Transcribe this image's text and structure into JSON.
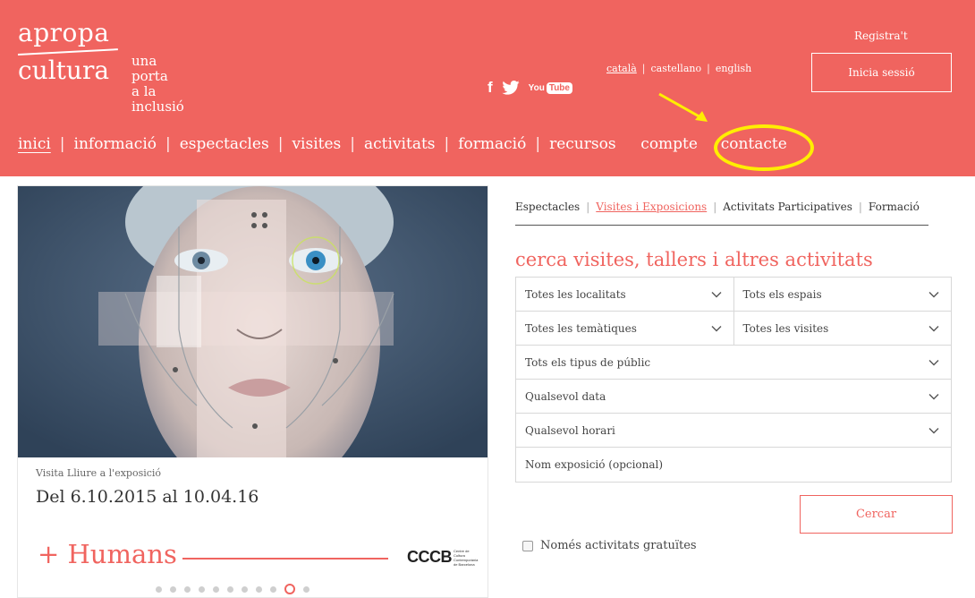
{
  "logo": {
    "top": "apropa",
    "bottom": "cultura",
    "tagline_line1": "una porta",
    "tagline_line2": "a la inclusió"
  },
  "social": {
    "facebook": "f",
    "youtube_prefix": "You",
    "youtube_box": "Tube"
  },
  "languages": {
    "catala": "català",
    "sep1": "|",
    "castellano": "castellano",
    "sep2": "|",
    "english": "english"
  },
  "account": {
    "register": "Registra't",
    "login": "Inicia sessió"
  },
  "nav": {
    "items": [
      {
        "label": "inici",
        "active": true
      },
      {
        "label": "informació"
      },
      {
        "label": "espectacles"
      },
      {
        "label": "visites"
      },
      {
        "label": "activitats"
      },
      {
        "label": "formació"
      },
      {
        "label": "recursos"
      },
      {
        "label": "compte"
      },
      {
        "label": "contacte"
      }
    ],
    "separator": "|"
  },
  "feature": {
    "caption": "Visita Lliure a l'exposició",
    "dates": "Del 6.10.2015 al 10.04.16",
    "title": "+ Humans",
    "partner_logo": "CCCB",
    "partner_sub": "Centre de Cultura Contemporània de Barcelona",
    "carousel_active_index": 9,
    "carousel_count": 11
  },
  "search": {
    "tabs": [
      {
        "label": "Espectacles"
      },
      {
        "label": "Visites i Exposicions",
        "active": true
      },
      {
        "label": "Activitats Participatives"
      },
      {
        "label": "Formació"
      }
    ],
    "tab_separator": "|",
    "title": "cerca visites, tallers i altres activitats",
    "filters": {
      "localitats": "Totes les localitats",
      "espais": "Tots els espais",
      "tematiques": "Totes les temàtiques",
      "visites": "Totes les visites",
      "public": "Tots els tipus de públic",
      "data": "Qualsevol data",
      "horari": "Qualsevol horari"
    },
    "expo_placeholder": "Nom exposició (opcional)",
    "button": "Cercar",
    "free_only": "Només activitats gratuïtes"
  },
  "colors": {
    "brand": "#f0645f",
    "highlight": "#ffee00"
  }
}
